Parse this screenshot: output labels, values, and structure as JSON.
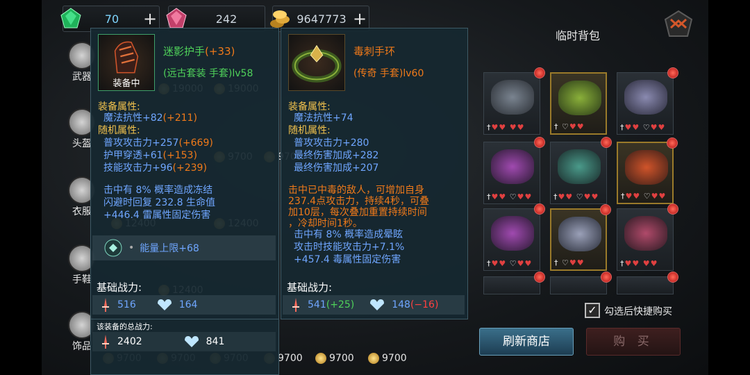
{
  "currency": [
    {
      "icon": "emerald-gem-icon",
      "value": "70",
      "plus": "+"
    },
    {
      "icon": "pink-gem-icon",
      "value": "242"
    },
    {
      "icon": "gold-coins-icon",
      "value": "9647773",
      "plus": "+"
    }
  ],
  "sidebar": [
    {
      "label": "武器",
      "icon": "sword-icon"
    },
    {
      "label": "头盔",
      "icon": "helmet-icon"
    },
    {
      "label": "衣服",
      "icon": "armor-icon"
    },
    {
      "label": "手鞋",
      "icon": "gauntlet-icon"
    },
    {
      "label": "饰品",
      "icon": "necklace-icon"
    }
  ],
  "background_prices": [
    "19000",
    "19000",
    "9700",
    "9700",
    "12400",
    "12400",
    "12400",
    "9700",
    "9700",
    "9700",
    "9700",
    "9700",
    "9700"
  ],
  "equipped": {
    "equipped_badge": "装备中",
    "name": "迷影护手",
    "name_bonus": "(+33)",
    "subtitle": "(远古套装 手套)lv58",
    "equip_attr_title": "装备属性:",
    "equip_attrs": [
      {
        "text": "魔法抗性+82",
        "bonus": "(+211)"
      }
    ],
    "random_attr_title": "随机属性:",
    "random_attrs": [
      {
        "text": "普攻攻击力+257",
        "bonus": "(+669)"
      },
      {
        "text": "护甲穿透+61",
        "bonus": "(+153)"
      },
      {
        "text": "技能攻击力+96",
        "bonus": "(+239)"
      }
    ],
    "effects": [
      "击中有 8% 概率造成冻结",
      "闪避时回复 232.8 生命值",
      "+446.4 雷属性固定伤害"
    ],
    "energy": "能量上限+68",
    "power_title": "基础战力:",
    "attack": "516",
    "defense": "164",
    "total_title": "该装备的总战力:",
    "total_attack": "2402",
    "total_defense": "841"
  },
  "compare": {
    "name": "毒刺手环",
    "subtitle": "(传奇 手套)lv60",
    "equip_attr_title": "装备属性:",
    "equip_attrs": [
      "魔法抗性+74"
    ],
    "random_attr_title": "随机属性:",
    "random_attrs": [
      "普攻攻击力+280",
      "最终伤害加成+282",
      "最终伤害加成+207"
    ],
    "passive": [
      "击中已中毒的敌人，可增加自身",
      "237.4点攻击力，持续4秒，可叠",
      "加10层，每次叠加重置持续时间",
      "，冷却时间1秒。"
    ],
    "effects": [
      "击中有 8% 概率造成晕眩",
      "攻击时技能攻击力+7.1%",
      "+457.4 毒属性固定伤害"
    ],
    "power_title": "基础战力:",
    "attack": "541",
    "attack_delta": "(+25)",
    "defense": "148",
    "defense_delta": "(−16)"
  },
  "shop": {
    "title": "临时背包",
    "checkbox_label": "勾选后快捷购买",
    "refresh_label": "刷新商店",
    "buy_label": "购 买"
  },
  "colors": {
    "attr_blue": "#6fa6ff",
    "bonus_orange": "#f07a1a",
    "green": "#4fd25a",
    "gold_title": "#f2c24d"
  }
}
